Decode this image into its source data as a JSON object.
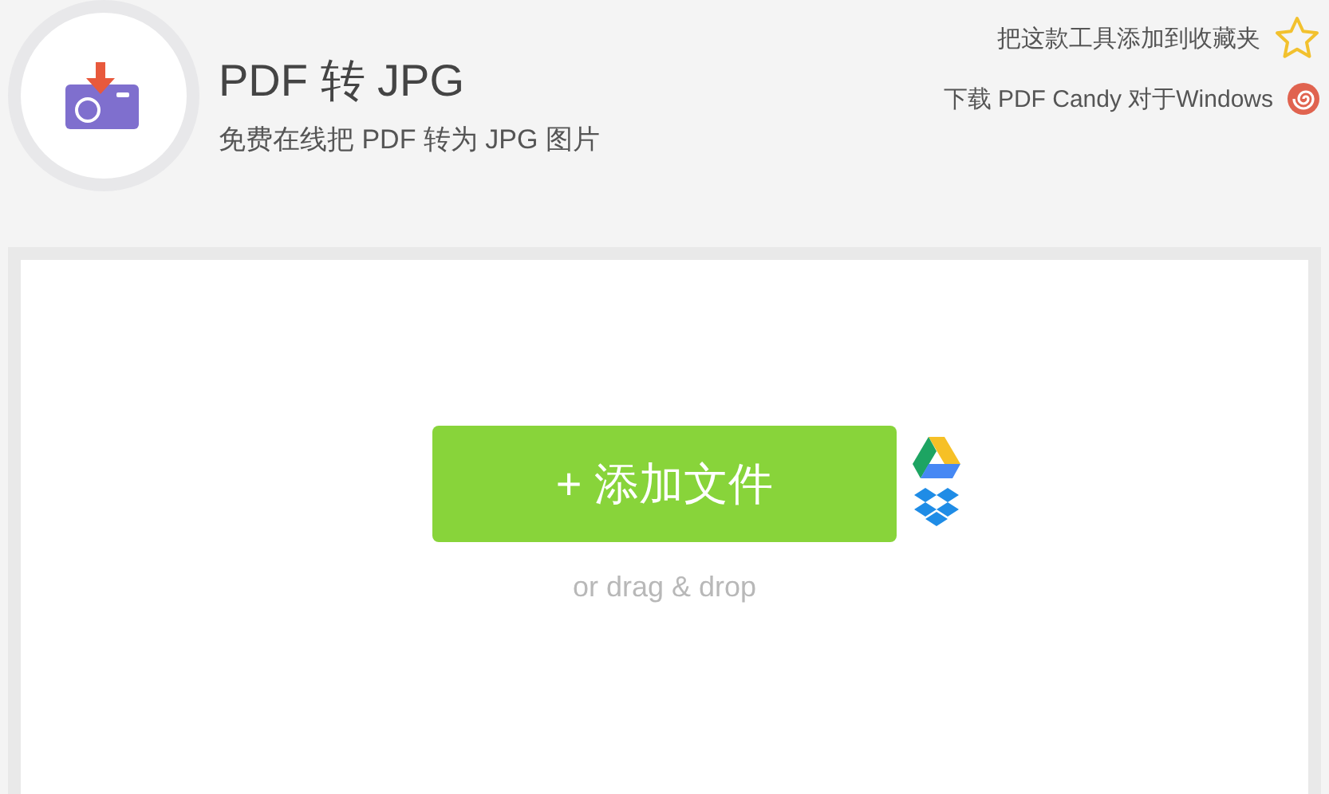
{
  "header": {
    "title": "PDF 转 JPG",
    "subtitle": "免费在线把 PDF 转为 JPG 图片"
  },
  "links": [
    {
      "kind": "bookmark",
      "label": "把这款工具添加到收藏夹"
    },
    {
      "kind": "download",
      "label": "下载 PDF Candy 对于Windows"
    }
  ],
  "upload": {
    "button": "+ 添加文件",
    "hint": "or drag & drop",
    "sources": [
      {
        "kind": "drive"
      },
      {
        "kind": "dropbox"
      }
    ]
  }
}
